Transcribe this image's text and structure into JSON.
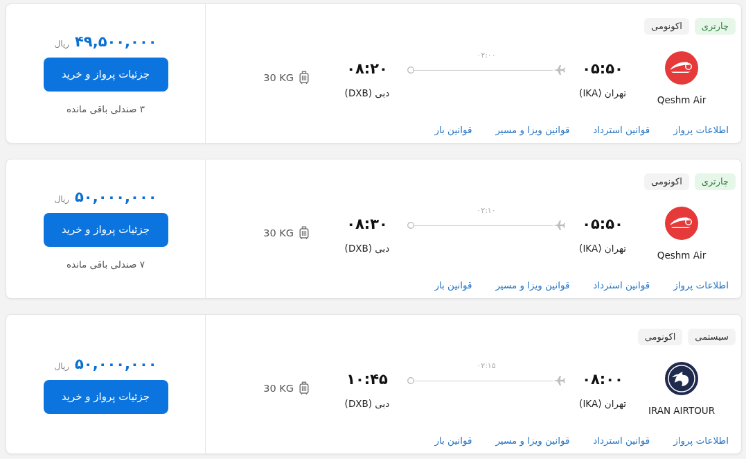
{
  "flights": [
    {
      "tags": [
        {
          "label": "چارتری",
          "kind": "charter"
        },
        {
          "label": "اکونومی",
          "kind": "cabin"
        }
      ],
      "airline": {
        "name": "Qeshm Air",
        "kind": "swoosh"
      },
      "departure": {
        "time": "۰۵:۵۰",
        "city": "تهران (IKA)"
      },
      "duration": "۰۲:۰۰",
      "arrival": {
        "time": "۰۸:۲۰",
        "city": "دبی (DXB)"
      },
      "baggage": "30 KG",
      "links": [
        "اطلاعات پرواز",
        "قوانین استرداد",
        "قوانین ویزا و مسیر",
        "قوانین بار"
      ],
      "price": "۴۹,۵۰۰,۰۰۰",
      "currency": "ریال",
      "button": "جزئیات پرواز و خرید",
      "seats_left": "۳ صندلی باقی مانده"
    },
    {
      "tags": [
        {
          "label": "چارتری",
          "kind": "charter"
        },
        {
          "label": "اکونومی",
          "kind": "cabin"
        }
      ],
      "airline": {
        "name": "Qeshm Air",
        "kind": "swoosh"
      },
      "departure": {
        "time": "۰۵:۵۰",
        "city": "تهران (IKA)"
      },
      "duration": "۰۲:۱۰",
      "arrival": {
        "time": "۰۸:۳۰",
        "city": "دبی (DXB)"
      },
      "baggage": "30 KG",
      "links": [
        "اطلاعات پرواز",
        "قوانین استرداد",
        "قوانین ویزا و مسیر",
        "قوانین بار"
      ],
      "price": "۵۰,۰۰۰,۰۰۰",
      "currency": "ریال",
      "button": "جزئیات پرواز و خرید",
      "seats_left": "۷ صندلی باقی مانده"
    },
    {
      "tags": [
        {
          "label": "سیستمی",
          "kind": "system"
        },
        {
          "label": "اکونومی",
          "kind": "cabin"
        }
      ],
      "airline": {
        "name": "IRAN AIRTOUR",
        "kind": "horse"
      },
      "departure": {
        "time": "۰۸:۰۰",
        "city": "تهران (IKA)"
      },
      "duration": "۰۲:۱۵",
      "arrival": {
        "time": "۱۰:۴۵",
        "city": "دبی (DXB)"
      },
      "baggage": "30 KG",
      "links": [
        "اطلاعات پرواز",
        "قوانین استرداد",
        "قوانین ویزا و مسیر",
        "قوانین بار"
      ],
      "price": "۵۰,۰۰۰,۰۰۰",
      "currency": "ریال",
      "button": "جزئیات پرواز و خرید"
    }
  ]
}
